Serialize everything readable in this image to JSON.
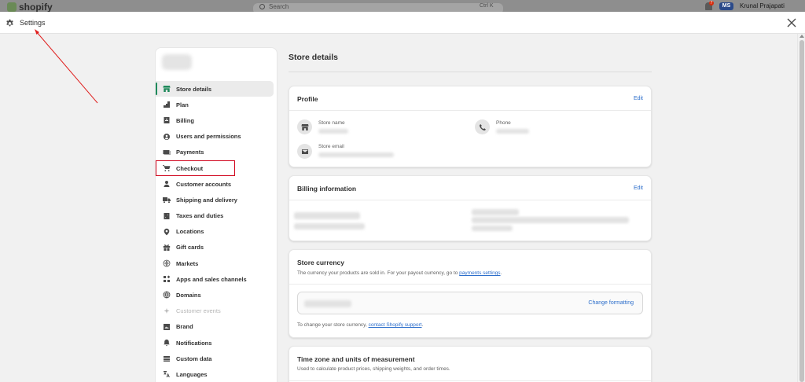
{
  "topbar": {
    "logo_text": "shopify",
    "search_placeholder": "Search",
    "search_shortcut": "Ctrl K",
    "notification_count": "7",
    "avatar_initials": "MS",
    "user_name": "Krunal Prajapati"
  },
  "header": {
    "title": "Settings"
  },
  "nav": {
    "items": [
      {
        "label": "Store details",
        "icon": "store-icon",
        "active": true
      },
      {
        "label": "Plan",
        "icon": "plan-icon"
      },
      {
        "label": "Billing",
        "icon": "billing-icon"
      },
      {
        "label": "Users and permissions",
        "icon": "user-circle-icon"
      },
      {
        "label": "Payments",
        "icon": "payments-icon"
      },
      {
        "label": "Checkout",
        "icon": "cart-icon",
        "highlighted": true
      },
      {
        "label": "Customer accounts",
        "icon": "person-icon"
      },
      {
        "label": "Shipping and delivery",
        "icon": "truck-icon"
      },
      {
        "label": "Taxes and duties",
        "icon": "tax-icon"
      },
      {
        "label": "Locations",
        "icon": "location-pin-icon"
      },
      {
        "label": "Gift cards",
        "icon": "gift-icon"
      },
      {
        "label": "Markets",
        "icon": "globe-icon"
      },
      {
        "label": "Apps and sales channels",
        "icon": "apps-icon"
      },
      {
        "label": "Domains",
        "icon": "domains-icon"
      },
      {
        "label": "Customer events",
        "icon": "sparkle-icon",
        "disabled": true
      },
      {
        "label": "Brand",
        "icon": "brand-icon"
      },
      {
        "label": "Notifications",
        "icon": "bell-icon"
      },
      {
        "label": "Custom data",
        "icon": "custom-data-icon"
      },
      {
        "label": "Languages",
        "icon": "language-icon"
      }
    ]
  },
  "main": {
    "page_title": "Store details",
    "profile": {
      "title": "Profile",
      "edit_label": "Edit",
      "store_name_label": "Store name",
      "phone_label": "Phone",
      "store_email_label": "Store email"
    },
    "billing": {
      "title": "Billing information",
      "edit_label": "Edit"
    },
    "currency": {
      "title": "Store currency",
      "description": "The currency your products are sold in. For your payout currency, go to ",
      "description_link": "payments settings",
      "description_end": ".",
      "change_formatting_label": "Change formatting",
      "footer_text": "To change your store currency, ",
      "footer_link": "contact Shopify support",
      "footer_end": "."
    },
    "timezone": {
      "title": "Time zone and units of measurement",
      "description": "Used to calculate product prices, shipping weights, and order times."
    }
  },
  "colors": {
    "accent_green": "#1f8a5b",
    "link_blue": "#2c6ecb",
    "annotation_red": "#d0021b"
  }
}
